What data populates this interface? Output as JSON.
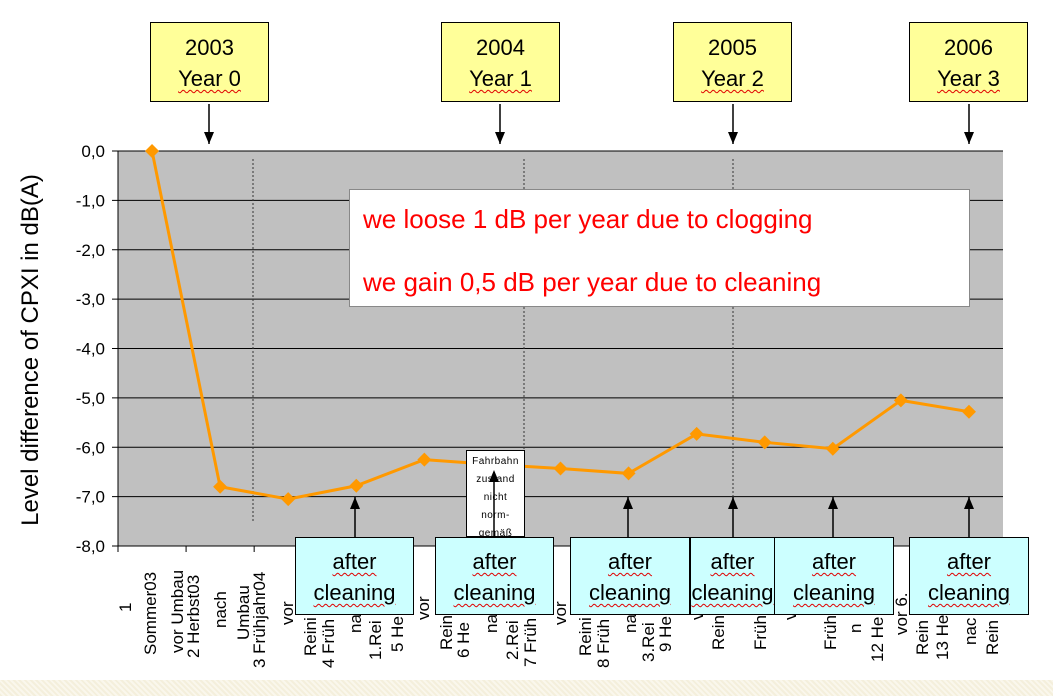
{
  "chart_data": {
    "type": "line",
    "ylabel": "Level difference of CPXI in dB(A)",
    "ylim": [
      -8,
      0
    ],
    "yticks": [
      "0,0",
      "-1,0",
      "-2,0",
      "-3,0",
      "-4,0",
      "-5,0",
      "-6,0",
      "-7,0",
      "-8,0"
    ],
    "grid": true,
    "series_color": "#ff9900",
    "plot_background": "#c0c0c0",
    "values": [
      0.0,
      -6.8,
      -7.05,
      -6.78,
      -6.25,
      -6.35,
      -6.43,
      -6.53,
      -5.73,
      -5.9,
      -6.03,
      -5.05,
      -5.28
    ],
    "category_label_fragments": [
      "1",
      "Sommer03",
      "vor Umbau",
      "2 Herbst03",
      "nach",
      "Umbau",
      "3 Frühjahr04",
      "vor",
      "Reini",
      "4 Früh",
      "na",
      "1.Rei",
      "5 He",
      "vor",
      "Rein",
      "6 He",
      "na",
      "2.Rei",
      "7 Früh",
      "vor",
      "Reini",
      "8 Früh",
      "na",
      "3.Rei",
      "9 He",
      "v",
      "Rein",
      "Früh",
      "v",
      "Früh",
      "n",
      "12 He",
      "vor 6.",
      "Rein",
      "13 He",
      "nac",
      "Rein"
    ],
    "year_boxes": [
      {
        "year": "2003",
        "label": "Year 0"
      },
      {
        "year": "2004",
        "label": "Year 1"
      },
      {
        "year": "2005",
        "label": "Year 2"
      },
      {
        "year": "2006",
        "label": "Year 3"
      }
    ],
    "annotation_lines": [
      "we loose 1 dB per year due to clogging",
      "we gain 0,5 dB per year due to cleaning"
    ],
    "cleaning_boxes": [
      {
        "line1": "after",
        "line2": "cleaning"
      },
      {
        "line1": "after",
        "line2": "cleaning"
      },
      {
        "line1": "after",
        "line2": "cleaning"
      },
      {
        "line1": "after",
        "line2": "cleaning"
      },
      {
        "line1": "after",
        "line2": "cleaning"
      },
      {
        "line1": "after",
        "line2": "cleaning"
      }
    ],
    "note_lines": [
      "Fahrbahn",
      "zustand",
      "nicht",
      "norm-",
      "gemäß"
    ]
  }
}
